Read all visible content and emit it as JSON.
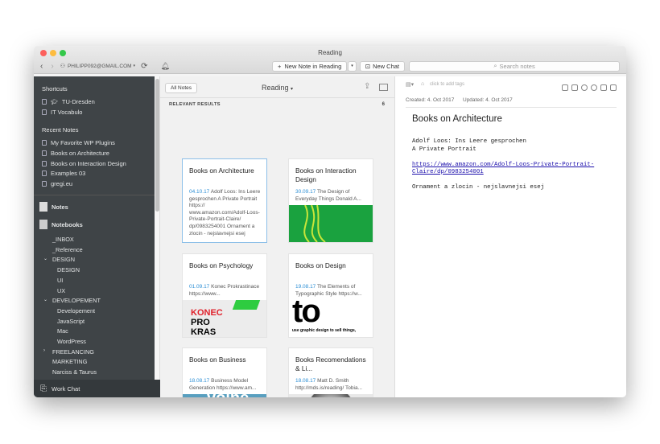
{
  "window": {
    "title": "Reading"
  },
  "toolbar": {
    "account": "PHILIPP092@GMAIL.COM",
    "new_note": "New Note in Reading",
    "new_chat": "New Chat",
    "search_placeholder": "Search notes"
  },
  "sidebar": {
    "shortcuts_title": "Shortcuts",
    "shortcuts": [
      "TU-Dresden",
      "IT Vocabulo"
    ],
    "recent_title": "Recent Notes",
    "recent": [
      "My Favorite WP Plugins",
      "Books on Architecture",
      "Books on Interaction Design",
      "Examples 03",
      "gregi.eu"
    ],
    "notes": "Notes",
    "notebooks": "Notebooks",
    "notebook_items": [
      {
        "label": "_INBOX",
        "level": 0
      },
      {
        "label": "_Reference",
        "level": 0
      },
      {
        "label": "DESIGN",
        "level": 0,
        "chevron": "down"
      },
      {
        "label": "DESIGN",
        "level": 1
      },
      {
        "label": "UI",
        "level": 1
      },
      {
        "label": "UX",
        "level": 1
      },
      {
        "label": "DEVELOPEMENT",
        "level": 0,
        "chevron": "down"
      },
      {
        "label": "Developement",
        "level": 1
      },
      {
        "label": "JavaScript",
        "level": 1
      },
      {
        "label": "Mac",
        "level": 1
      },
      {
        "label": "WordPress",
        "level": 1
      },
      {
        "label": "FREELANCING",
        "level": 0,
        "chevron": "right"
      },
      {
        "label": "MARKETING",
        "level": 0
      },
      {
        "label": "Narciss & Taurus",
        "level": 0
      }
    ],
    "work_chat": "Work Chat"
  },
  "list": {
    "all_notes": "All Notes",
    "notebook": "Reading",
    "results_label": "RELEVANT RESULTS",
    "results_count": "6",
    "cards": [
      {
        "title": "Books on Architecture",
        "date": "04.10.17",
        "snippet": "Adolf Loos: Ins Leere gesprochen A Private Portrait https:// www.amazon.com/Adolf-Loos-Private-Portrait-Claire/ dp/0983254001 Ornament a zlocin - nejslavnejsi esej",
        "selected": true
      },
      {
        "title": "Books on Interaction Design",
        "date": "30.09.17",
        "snippet": "The Design of Everyday Things Donald A..."
      },
      {
        "title": "Books on Psychology",
        "date": "01.09.17",
        "snippet": "Konec Prokrastinace https://www..."
      },
      {
        "title": "Books on Design",
        "date": "19.08.17",
        "snippet": "The Elements of Typographic Style https://w..."
      },
      {
        "title": "Books on Business",
        "date": "18.08.17",
        "snippet": "Business Model Generation https://www.am..."
      },
      {
        "title": "Books Recomendations & Li...",
        "date": "18.08.17",
        "snippet": "Matt D. Smith http://mds.is/reading/ Tobia..."
      }
    ],
    "image_texts": {
      "psych": [
        "KONEC",
        "PRO",
        "KRAS"
      ],
      "design": [
        "to",
        "use graphic design to sell things,"
      ],
      "business": [
        "volne",
        "noze"
      ]
    }
  },
  "editor": {
    "tags_placeholder": "click to add tags",
    "created": "Created: 4. Oct 2017",
    "updated": "Updated: 4. Oct 2017",
    "title": "Books on Architecture",
    "lines": [
      "Adolf Loos: Ins Leere gesprochen",
      "A Private Portrait"
    ],
    "link": "https://www.amazon.com/Adolf-Loos-Private-Portrait-Claire/dp/0983254001",
    "last_line": "Ornament a zlocin - nejslavnejsi esej"
  },
  "colors": {
    "sidebar": "#3f4447",
    "accent": "#2d8fd5",
    "link": "#1a0dab"
  }
}
